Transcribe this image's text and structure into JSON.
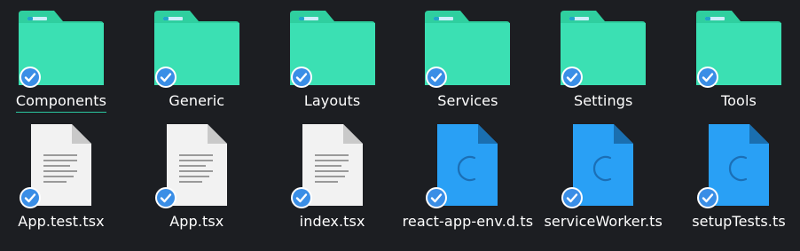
{
  "colors": {
    "background": "#1c1e22",
    "folder": "#3be0b3",
    "folder_tab": "#2fcf9f",
    "check": "#3a8ee6",
    "ts_file": "#29a0f5",
    "doc_file": "#f2f2f2"
  },
  "folders": [
    {
      "label": "Components",
      "icon": "folder-icon",
      "selected": true
    },
    {
      "label": "Generic",
      "icon": "folder-icon"
    },
    {
      "label": "Layouts",
      "icon": "folder-icon"
    },
    {
      "label": "Services",
      "icon": "folder-icon"
    },
    {
      "label": "Settings",
      "icon": "folder-icon"
    },
    {
      "label": "Tools",
      "icon": "folder-icon"
    }
  ],
  "files": [
    {
      "label": "App.test.tsx",
      "icon": "text-file-icon"
    },
    {
      "label": "App.tsx",
      "icon": "text-file-icon"
    },
    {
      "label": "index.tsx",
      "icon": "text-file-icon"
    },
    {
      "label": "react-app-env.d.ts",
      "icon": "typescript-file-icon"
    },
    {
      "label": "serviceWorker.ts",
      "icon": "typescript-file-icon"
    },
    {
      "label": "setupTests.ts",
      "icon": "typescript-file-icon"
    }
  ]
}
